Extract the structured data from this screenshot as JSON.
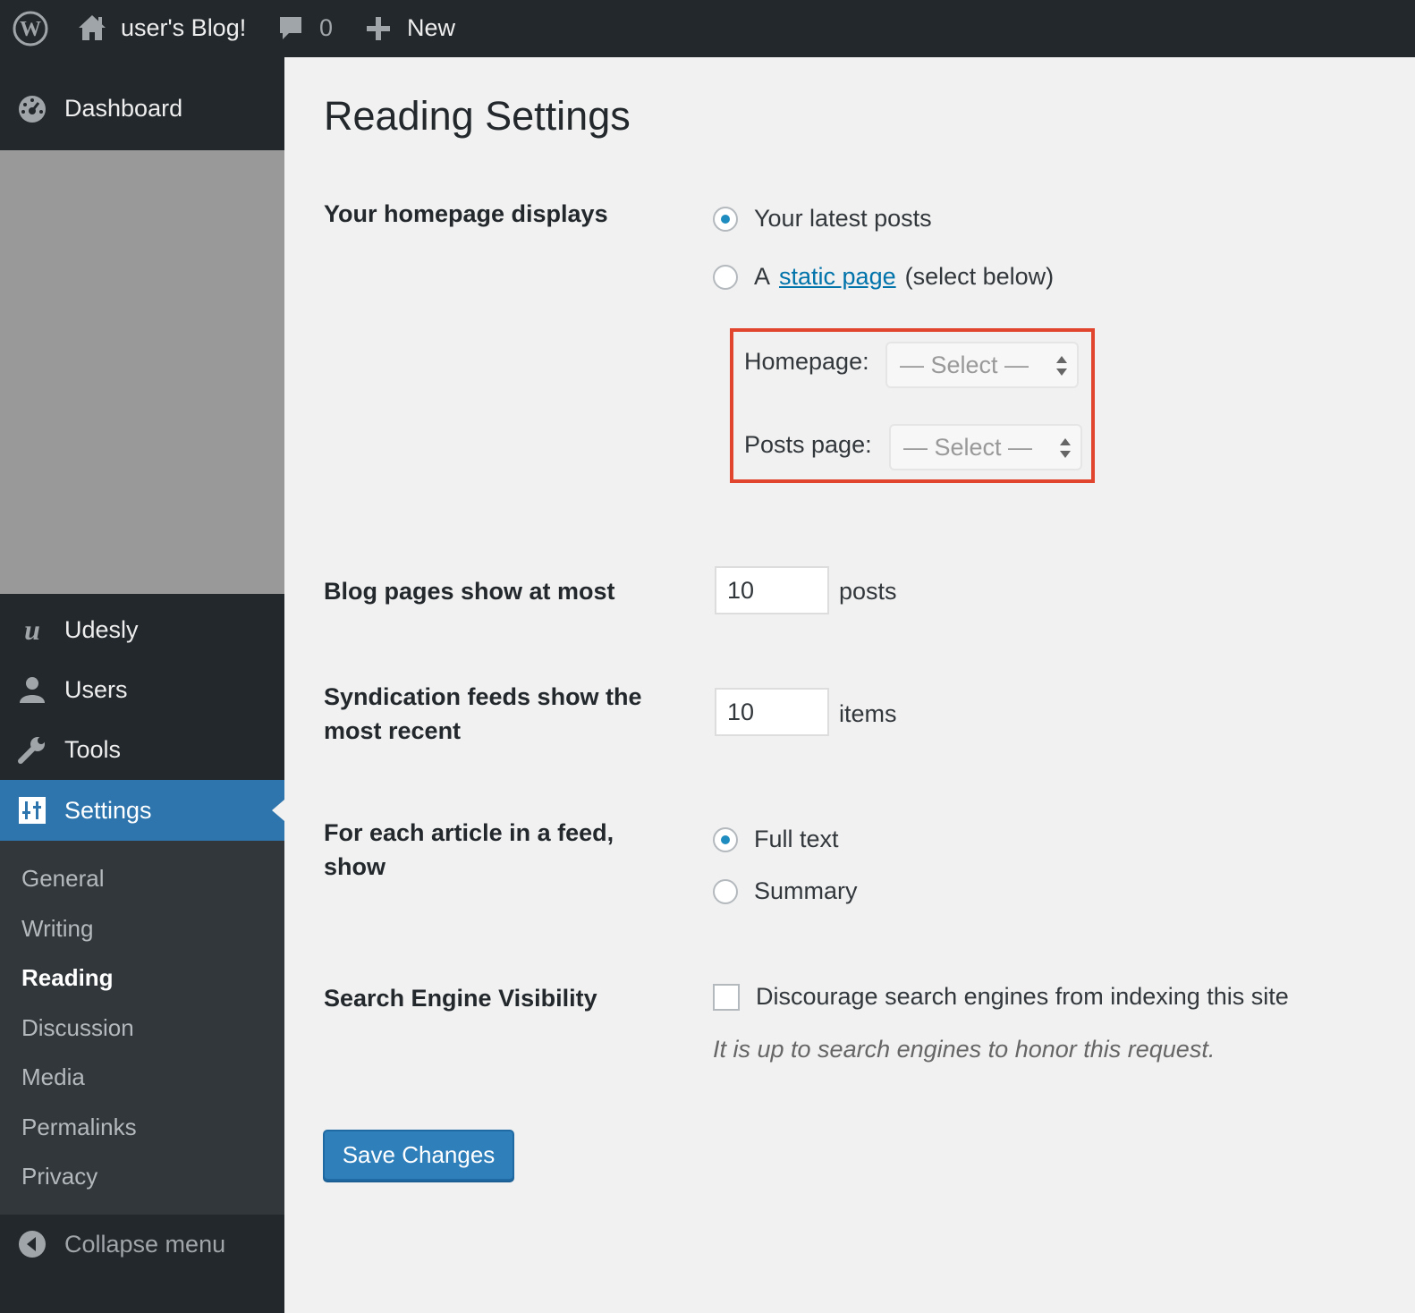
{
  "adminbar": {
    "site_name": "user's Blog!",
    "comment_count": "0",
    "new_label": "New"
  },
  "sidebar": {
    "dashboard": "Dashboard",
    "udesly": "Udesly",
    "users": "Users",
    "tools": "Tools",
    "settings": "Settings",
    "submenu": [
      "General",
      "Writing",
      "Reading",
      "Discussion",
      "Media",
      "Permalinks",
      "Privacy"
    ],
    "current_submenu": "Reading",
    "collapse": "Collapse menu"
  },
  "page": {
    "title": "Reading Settings",
    "homepage_displays": {
      "label": "Your homepage displays",
      "option_latest": "Your latest posts",
      "option_static_prefix": "A",
      "option_static_link": "static page",
      "option_static_suffix": "(select below)",
      "selected": "latest"
    },
    "homepage_select": {
      "label": "Homepage:",
      "value": "— Select —"
    },
    "posts_page_select": {
      "label": "Posts page:",
      "value": "— Select —"
    },
    "blog_pages": {
      "label": "Blog pages show at most",
      "value": "10",
      "unit": "posts"
    },
    "syndication": {
      "label_line1": "Syndication feeds show the",
      "label_line2": "most recent",
      "value": "10",
      "unit": "items"
    },
    "feed_article": {
      "label_line1": "For each article in a feed,",
      "label_line2": "show",
      "option_full": "Full text",
      "option_summary": "Summary",
      "selected": "full"
    },
    "search_visibility": {
      "label": "Search Engine Visibility",
      "checkbox_label": "Discourage search engines from indexing this site",
      "checked": false,
      "description": "It is up to search engines to honor this request."
    },
    "save_label": "Save Changes"
  },
  "colors": {
    "adminbar_bg": "#23282d",
    "active_menu": "#2e75ad",
    "link": "#0073aa",
    "primary_button": "#2f7fbb",
    "highlight": "#e2452e"
  }
}
